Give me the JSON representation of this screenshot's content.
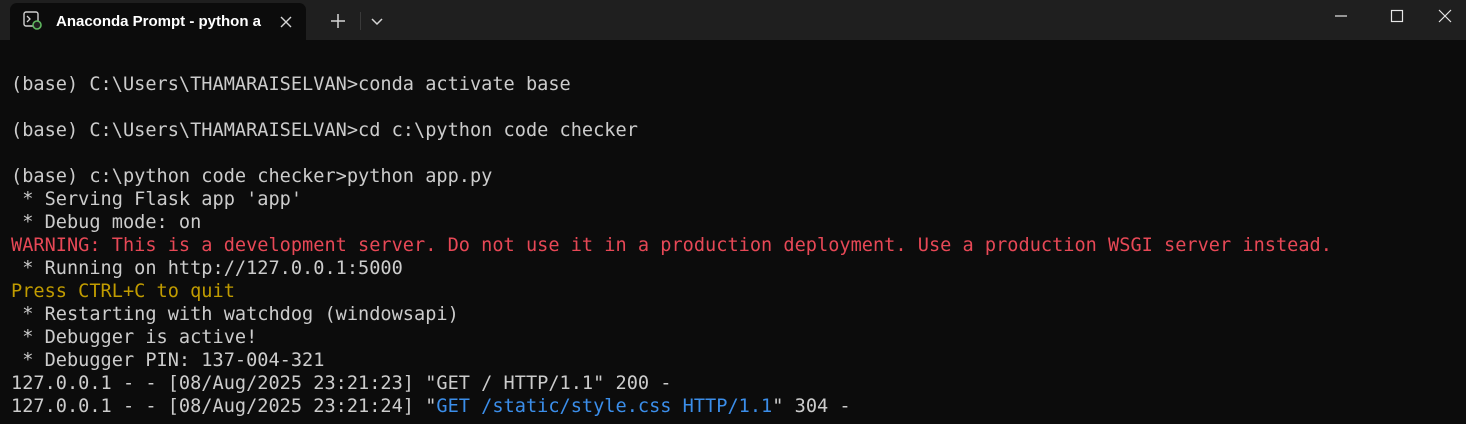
{
  "window": {
    "tab_title": "Anaconda Prompt - python  a",
    "tab_icon": "terminal-icon",
    "colors": {
      "background": "#0c0c0c",
      "titlebar": "#1f1f1f",
      "text": "#cccccc",
      "warning": "#e74856",
      "quit": "#c19c00",
      "link": "#3b8eea"
    }
  },
  "terminal": {
    "lines": [
      "(base) C:\\Users\\THAMARAISELVAN>conda activate base",
      "(base) C:\\Users\\THAMARAISELVAN>cd c:\\python code checker",
      "(base) c:\\python code checker>python app.py",
      " * Serving Flask app 'app'",
      " * Debug mode: on",
      "WARNING: This is a development server. Do not use it in a production deployment. Use a production WSGI server instead.",
      " * Running on http://127.0.0.1:5000",
      "Press CTRL+C to quit",
      " * Restarting with watchdog (windowsapi)",
      " * Debugger is active!",
      " * Debugger PIN: 137-004-321",
      "127.0.0.1 - - [08/Aug/2025 23:21:23] \"GET / HTTP/1.1\" 200 -"
    ],
    "last_line": {
      "prefix": "127.0.0.1 - - [08/Aug/2025 23:21:24] \"",
      "request": "GET /static/style.css HTTP/1.1",
      "suffix": "\" 304 -"
    }
  }
}
